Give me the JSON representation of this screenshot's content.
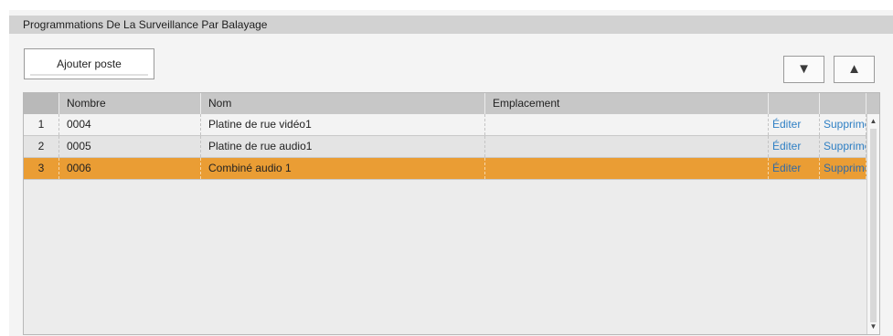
{
  "panel": {
    "title": "Programmations De La Surveillance Par Balayage"
  },
  "toolbar": {
    "add_label": "Ajouter poste",
    "move_down_icon": "triangle-down-icon",
    "move_down_glyph": "▼",
    "move_up_icon": "triangle-up-icon",
    "move_up_glyph": "▲"
  },
  "table": {
    "columns": [
      "",
      "Nombre",
      "Nom",
      "Emplacement",
      "",
      ""
    ],
    "rows": [
      {
        "index": "1",
        "number": "0004",
        "name": "Platine de rue vidéo1",
        "location": "",
        "edit": "Éditer",
        "delete": "Supprimer"
      },
      {
        "index": "2",
        "number": "0005",
        "name": "Platine de rue audio1",
        "location": "",
        "edit": "Éditer",
        "delete": "Supprimer"
      },
      {
        "index": "3",
        "number": "0006",
        "name": "Combiné audio 1",
        "location": "",
        "edit": "Éditer",
        "delete": "Supprimer"
      }
    ],
    "selected_row": 3,
    "scroll_up_glyph": "▲",
    "scroll_down_glyph": "▼"
  },
  "colors": {
    "header_bar": "#d2d2d2",
    "selected_row": "#ea9d34",
    "link": "#2e7fc4"
  }
}
